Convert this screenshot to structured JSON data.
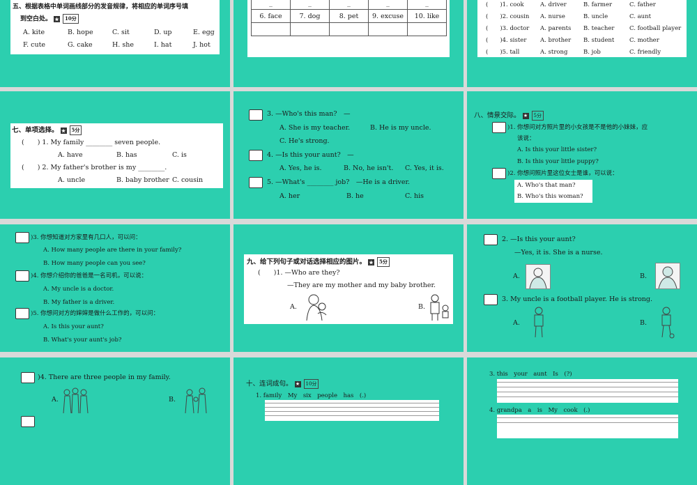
{
  "s1": {
    "title": "五、根据表格中单词画线部分的发音规律，将相应的单词序号填",
    "title2": "到空白处。",
    "score": "10分",
    "row1": [
      "A. kite",
      "B. hope",
      "C. sit",
      "D. up",
      "E. egg"
    ],
    "row2": [
      "F. cute",
      "G. cake",
      "H. she",
      "I. hat",
      "J. hot"
    ]
  },
  "s2": {
    "words": [
      "6. face",
      "7. dog",
      "8. pet",
      "9. excuse",
      "10. like"
    ]
  },
  "s3": {
    "rows": [
      [
        "(　　)1. cook",
        "A. driver",
        "B. farmer",
        "C. father"
      ],
      [
        "(　　)2. cousin",
        "A. nurse",
        "B. uncle",
        "C. aunt"
      ],
      [
        "(　　)3. doctor",
        "A. parents",
        "B. teacher",
        "C. football player"
      ],
      [
        "(　　)4. sister",
        "A. brother",
        "B. student",
        "C. mother"
      ],
      [
        "(　　)5. tall",
        "A. strong",
        "B. job",
        "C. friendly"
      ]
    ]
  },
  "s4": {
    "title": "七、单项选择。",
    "score": "5分",
    "q1": "(　　) 1. My family ________ seven people.",
    "q1opts": [
      "A. have",
      "B. has",
      "C. is"
    ],
    "q2": "(　　) 2. My father's brother is my ________.",
    "q2opts": [
      "A. uncle",
      "B. baby brother",
      "C. cousin"
    ]
  },
  "s5": {
    "q3": "3. —Who's this man?　—",
    "q3opts": [
      "A. She is my teacher.",
      "B. He is my uncle.",
      "C. He's strong."
    ],
    "q4": "4. —Is this your aunt?　—",
    "q4opts": [
      "A. Yes, he is.",
      "B. No, he isn't.",
      "C. Yes, it is."
    ],
    "q5": "5. —What's ________ job?　—He is a driver.",
    "q5opts": [
      "A. her",
      "B. he",
      "C. his"
    ]
  },
  "s6": {
    "title": "八、情景交际。",
    "score": "5分",
    "q1": ")1. 你想问对方照片里的小女孩是不是他的小妹妹，应",
    "q1b": "该说：",
    "q1opts": [
      "A. Is this your little sister?",
      "B. Is this your little puppy?"
    ],
    "q2": ")2. 你想问照片里这位女士是谁，可以说：",
    "q2opts": [
      "A. Who's that man?",
      "B. Who's this woman?"
    ]
  },
  "s7": {
    "q3": ")3. 你想知道对方家里有几口人，可以问：",
    "q3opts": [
      "A. How many people are there in your family?",
      "B. How many people can you see?"
    ],
    "q4": ")4. 你想介绍你的爸爸是一名司机，可以说：",
    "q4opts": [
      "A. My uncle is a doctor.",
      "B. My father is a driver."
    ],
    "q5": ")5. 你想问对方的婶婶是做什么工作的，可以问：",
    "q5opts": [
      "A. Is this your aunt?",
      "B. What's your aunt's job?"
    ]
  },
  "s8": {
    "title": "九、给下列句子或对话选择相应的图片。",
    "score": "5分",
    "q1": "(　　)1. —Who are they?",
    "q1b": "—They are my mother and my baby brother.",
    "optA": "A.",
    "optB": "B."
  },
  "s9": {
    "q2": "2. —Is this your aunt?",
    "q2b": "—Yes, it is. She is a nurse.",
    "q3": "3. My uncle is a football player. He is strong.",
    "optA": "A.",
    "optB": "B."
  },
  "s10": {
    "q4": ")4. There are three people in my family.",
    "optA": "A.",
    "optB": "B."
  },
  "s11": {
    "title": "十、连词成句。",
    "score": "10分",
    "q1": "1. family　My　six　people　has　(.)"
  },
  "s12": {
    "q3": "3. this　your　aunt　Is　(?)",
    "q4": "4. grandpa　a　is　My　cook　(.)"
  }
}
